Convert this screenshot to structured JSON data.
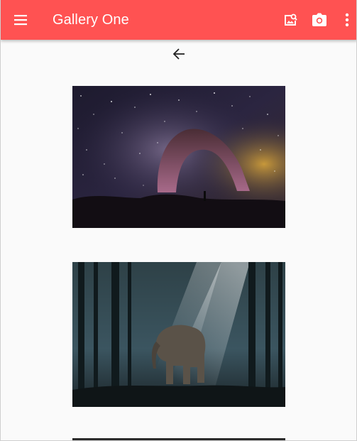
{
  "app": {
    "title": "Gallery One",
    "accent_color": "#ff5252"
  },
  "toolbar": {
    "menu_icon": "menu-icon",
    "actions": [
      {
        "icon": "image-search-icon"
      },
      {
        "icon": "camera-icon"
      },
      {
        "icon": "more-vert-icon"
      }
    ]
  },
  "navigation": {
    "back_icon": "arrow-back-icon"
  },
  "gallery": {
    "photos": [
      {
        "subject": "starry-sky-arch"
      },
      {
        "subject": "elephant-in-forest"
      },
      {
        "subject": "dark-photo-partial"
      }
    ]
  }
}
